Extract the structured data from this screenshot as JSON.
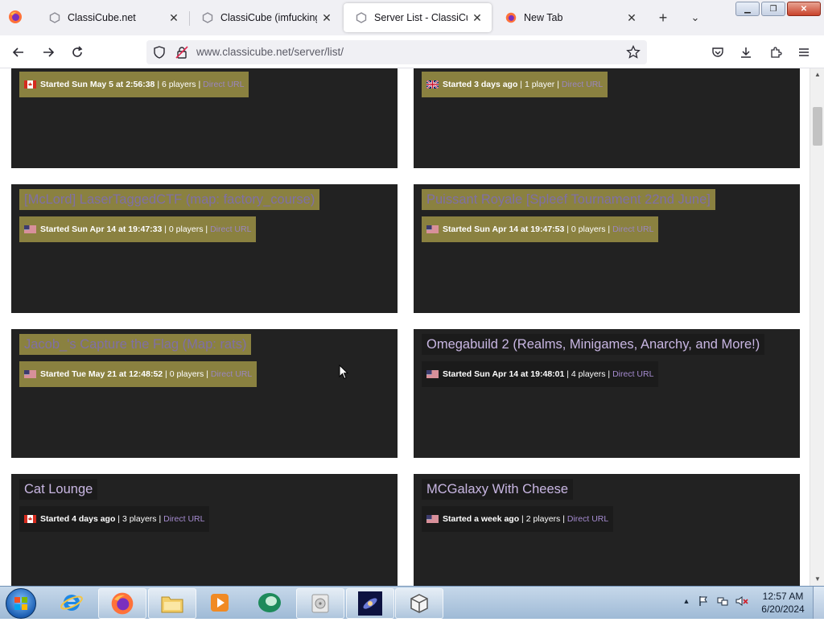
{
  "browser": {
    "tabs": [
      {
        "title": "ClassiCube.net",
        "active": false
      },
      {
        "title": "ClassiCube (imfuckingo...",
        "active": false
      },
      {
        "title": "Server List - ClassiCube.n",
        "active": true
      },
      {
        "title": "New Tab",
        "active": false
      }
    ],
    "url": "www.classicube.net/server/list/"
  },
  "server_cards": [
    {
      "title": "",
      "flag": "ca",
      "started": "Started Sun May 5 at 2:56:38",
      "info": "| 6 players |",
      "link": "Direct URL",
      "highlighted": true
    },
    {
      "title": "",
      "flag": "gb",
      "started": "Started 3 days ago",
      "info": "| 1 player |",
      "link": "Direct URL",
      "highlighted": true
    },
    {
      "title": "[McLord] LaserTaggedCTF (map: factory_course)",
      "flag": "us",
      "started": "Started Sun Apr 14 at 19:47:33",
      "info": "| 0 players |",
      "link": "Direct URL",
      "highlighted": true
    },
    {
      "title": "Puissant Royale [Spleef Tournament 22nd June]",
      "flag": "us",
      "started": "Started Sun Apr 14 at 19:47:53",
      "info": "| 0 players |",
      "link": "Direct URL",
      "highlighted": true
    },
    {
      "title": "Jacob_'s Capture the Flag (Map: rats)",
      "flag": "us",
      "started": "Started Tue May 21 at 12:48:52",
      "info": "| 0 players |",
      "link": "Direct URL",
      "highlighted": true
    },
    {
      "title": "Omegabuild 2 (Realms, Minigames, Anarchy, and More!)",
      "flag": "us",
      "started": "Started Sun Apr 14 at 19:48:01",
      "info": "| 4 players |",
      "link": "Direct URL",
      "highlighted": false
    },
    {
      "title": "Cat Lounge",
      "flag": "ca",
      "started": "Started 4 days ago",
      "info": "| 3 players |",
      "link": "Direct URL",
      "highlighted": false
    },
    {
      "title": "MCGalaxy With Cheese",
      "flag": "us",
      "started": "Started a week ago",
      "info": "| 2 players |",
      "link": "Direct URL",
      "highlighted": false
    }
  ],
  "taskbar": {
    "time": "12:57 AM",
    "date": "6/20/2024"
  },
  "colors": {
    "card_bg": "#222222",
    "selection_highlight": "#8a8140",
    "link": "#a58bd0",
    "title_text": "#c8b6e2"
  }
}
